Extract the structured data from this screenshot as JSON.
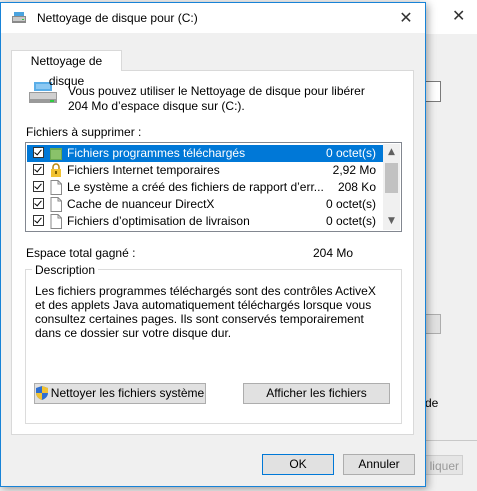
{
  "dialog": {
    "title": "Nettoyage de disque pour  (C:)",
    "close_glyph": "✕"
  },
  "background_window": {
    "close_glyph": "✕",
    "partial_text": "de",
    "partial_button": "liquer"
  },
  "tab": {
    "label": "Nettoyage de disque"
  },
  "intro_text": "Vous pouvez utiliser le Nettoyage de disque pour libérer 204 Mo d’espace disque sur  (C:).",
  "files_label": "Fichiers à supprimer :",
  "files": [
    {
      "checked": true,
      "name": "Fichiers programmes téléchargés",
      "size": "0 octet(s)",
      "selected": true,
      "icon": "folder-icon"
    },
    {
      "checked": true,
      "name": "Fichiers Internet temporaires",
      "size": "2,92 Mo",
      "selected": false,
      "icon": "lock-icon"
    },
    {
      "checked": true,
      "name": "Le système a créé des fichiers de rapport d’err...",
      "size": "208 Ko",
      "selected": false,
      "icon": "file-icon"
    },
    {
      "checked": true,
      "name": "Cache de nuanceur DirectX",
      "size": "0 octet(s)",
      "selected": false,
      "icon": "file-icon"
    },
    {
      "checked": true,
      "name": "Fichiers d’optimisation de livraison",
      "size": "0 octet(s)",
      "selected": false,
      "icon": "file-icon"
    }
  ],
  "total": {
    "label": "Espace total gagné :",
    "value": "204 Mo"
  },
  "description": {
    "title": "Description",
    "text": "Les fichiers programmes téléchargés sont des contrôles ActiveX et des applets Java automatiquement téléchargés lorsque vous consultez certaines pages. Ils sont conservés temporairement dans ce dossier sur votre disque dur."
  },
  "buttons": {
    "clean_system": "Nettoyer les fichiers système",
    "show_files": "Afficher les fichiers",
    "ok": "OK",
    "cancel": "Annuler"
  },
  "colors": {
    "accent": "#0078d7",
    "selection": "#0078d7"
  }
}
